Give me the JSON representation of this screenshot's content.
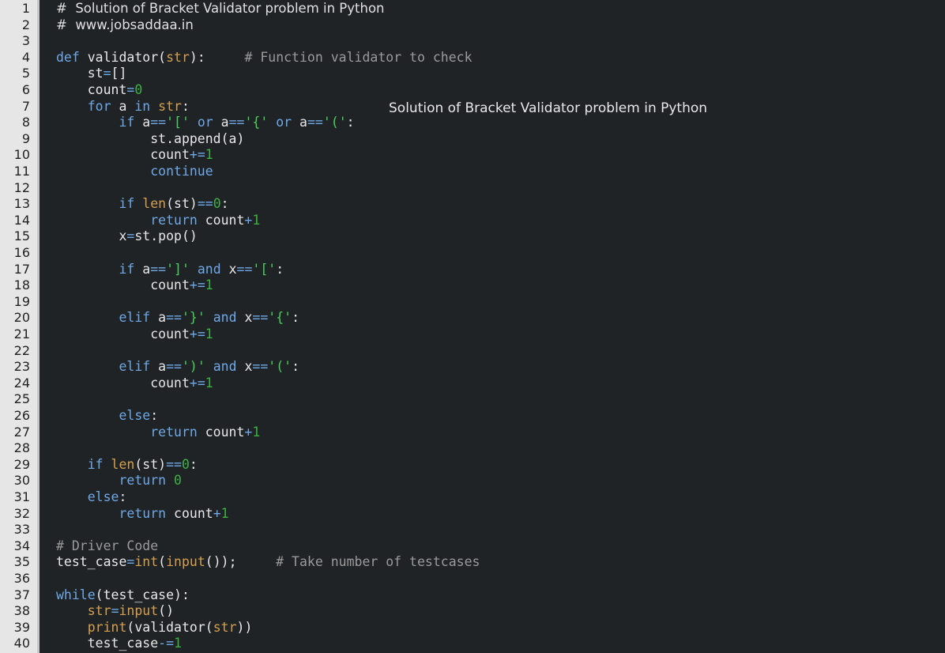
{
  "editor": {
    "overlay_title": "Solution of Bracket Validator problem in Python",
    "colors": {
      "background": "#1f2326",
      "gutter": "#e6e6e6",
      "keyword": "#6fa8e6",
      "builtin": "#d4a04f",
      "string": "#4ad05a",
      "number": "#3cb043",
      "comment": "#9a9a9a",
      "text": "#e8e8e8"
    },
    "lines": [
      {
        "n": "1",
        "prose": true,
        "tokens": [
          [
            "hdr",
            "#  Solution of Bracket Validator problem in Python"
          ]
        ]
      },
      {
        "n": "2",
        "prose": true,
        "tokens": [
          [
            "hdr",
            "#  www.jobsaddaa.in"
          ]
        ]
      },
      {
        "n": "3",
        "tokens": []
      },
      {
        "n": "4",
        "tokens": [
          [
            "kw",
            "def"
          ],
          [
            "pl",
            " validator("
          ],
          [
            "bi",
            "str"
          ],
          [
            "pl",
            "):     "
          ],
          [
            "com",
            "# Function validator to check"
          ]
        ]
      },
      {
        "n": "5",
        "tokens": [
          [
            "pl",
            "    st"
          ],
          [
            "op",
            "="
          ],
          [
            "pl",
            "[]"
          ]
        ]
      },
      {
        "n": "6",
        "tokens": [
          [
            "pl",
            "    count"
          ],
          [
            "op",
            "="
          ],
          [
            "num",
            "0"
          ]
        ]
      },
      {
        "n": "7",
        "tokens": [
          [
            "kw",
            "    for"
          ],
          [
            "pl",
            " a "
          ],
          [
            "kw",
            "in"
          ],
          [
            "pl",
            " "
          ],
          [
            "bi",
            "str"
          ],
          [
            "pl",
            ":"
          ]
        ]
      },
      {
        "n": "8",
        "tokens": [
          [
            "kw",
            "        if"
          ],
          [
            "pl",
            " a"
          ],
          [
            "op",
            "=="
          ],
          [
            "str",
            "'['"
          ],
          [
            "pl",
            " "
          ],
          [
            "kw",
            "or"
          ],
          [
            "pl",
            " a"
          ],
          [
            "op",
            "=="
          ],
          [
            "str",
            "'{'"
          ],
          [
            "pl",
            " "
          ],
          [
            "kw",
            "or"
          ],
          [
            "pl",
            " a"
          ],
          [
            "op",
            "=="
          ],
          [
            "str",
            "'('"
          ],
          [
            "pl",
            ":"
          ]
        ]
      },
      {
        "n": "9",
        "tokens": [
          [
            "pl",
            "            st.append(a)"
          ]
        ]
      },
      {
        "n": "10",
        "tokens": [
          [
            "pl",
            "            count"
          ],
          [
            "op",
            "+="
          ],
          [
            "num",
            "1"
          ]
        ]
      },
      {
        "n": "11",
        "tokens": [
          [
            "kw",
            "            continue"
          ]
        ]
      },
      {
        "n": "12",
        "tokens": []
      },
      {
        "n": "13",
        "tokens": [
          [
            "kw",
            "        if"
          ],
          [
            "pl",
            " "
          ],
          [
            "bi",
            "len"
          ],
          [
            "pl",
            "(st)"
          ],
          [
            "op",
            "=="
          ],
          [
            "num",
            "0"
          ],
          [
            "pl",
            ":"
          ]
        ]
      },
      {
        "n": "14",
        "tokens": [
          [
            "kw",
            "            return"
          ],
          [
            "pl",
            " count"
          ],
          [
            "op",
            "+"
          ],
          [
            "num",
            "1"
          ]
        ]
      },
      {
        "n": "15",
        "tokens": [
          [
            "pl",
            "        x"
          ],
          [
            "op",
            "="
          ],
          [
            "pl",
            "st.pop()"
          ]
        ]
      },
      {
        "n": "16",
        "tokens": []
      },
      {
        "n": "17",
        "tokens": [
          [
            "kw",
            "        if"
          ],
          [
            "pl",
            " a"
          ],
          [
            "op",
            "=="
          ],
          [
            "str",
            "']'"
          ],
          [
            "pl",
            " "
          ],
          [
            "kw",
            "and"
          ],
          [
            "pl",
            " x"
          ],
          [
            "op",
            "=="
          ],
          [
            "str",
            "'['"
          ],
          [
            "pl",
            ":"
          ]
        ]
      },
      {
        "n": "18",
        "tokens": [
          [
            "pl",
            "            count"
          ],
          [
            "op",
            "+="
          ],
          [
            "num",
            "1"
          ]
        ]
      },
      {
        "n": "19",
        "tokens": []
      },
      {
        "n": "20",
        "tokens": [
          [
            "kw",
            "        elif"
          ],
          [
            "pl",
            " a"
          ],
          [
            "op",
            "=="
          ],
          [
            "str",
            "'}'"
          ],
          [
            "pl",
            " "
          ],
          [
            "kw",
            "and"
          ],
          [
            "pl",
            " x"
          ],
          [
            "op",
            "=="
          ],
          [
            "str",
            "'{'"
          ],
          [
            "pl",
            ":"
          ]
        ]
      },
      {
        "n": "21",
        "tokens": [
          [
            "pl",
            "            count"
          ],
          [
            "op",
            "+="
          ],
          [
            "num",
            "1"
          ]
        ]
      },
      {
        "n": "22",
        "tokens": []
      },
      {
        "n": "23",
        "tokens": [
          [
            "kw",
            "        elif"
          ],
          [
            "pl",
            " a"
          ],
          [
            "op",
            "=="
          ],
          [
            "str",
            "')'"
          ],
          [
            "pl",
            " "
          ],
          [
            "kw",
            "and"
          ],
          [
            "pl",
            " x"
          ],
          [
            "op",
            "=="
          ],
          [
            "str",
            "'('"
          ],
          [
            "pl",
            ":"
          ]
        ]
      },
      {
        "n": "24",
        "tokens": [
          [
            "pl",
            "            count"
          ],
          [
            "op",
            "+="
          ],
          [
            "num",
            "1"
          ]
        ]
      },
      {
        "n": "25",
        "tokens": []
      },
      {
        "n": "26",
        "tokens": [
          [
            "kw",
            "        else"
          ],
          [
            "pl",
            ":"
          ]
        ]
      },
      {
        "n": "27",
        "tokens": [
          [
            "kw",
            "            return"
          ],
          [
            "pl",
            " count"
          ],
          [
            "op",
            "+"
          ],
          [
            "num",
            "1"
          ]
        ]
      },
      {
        "n": "28",
        "tokens": []
      },
      {
        "n": "29",
        "tokens": [
          [
            "kw",
            "    if"
          ],
          [
            "pl",
            " "
          ],
          [
            "bi",
            "len"
          ],
          [
            "pl",
            "(st)"
          ],
          [
            "op",
            "=="
          ],
          [
            "num",
            "0"
          ],
          [
            "pl",
            ":"
          ]
        ]
      },
      {
        "n": "30",
        "tokens": [
          [
            "kw",
            "        return"
          ],
          [
            "pl",
            " "
          ],
          [
            "num",
            "0"
          ]
        ]
      },
      {
        "n": "31",
        "tokens": [
          [
            "kw",
            "    else"
          ],
          [
            "pl",
            ":"
          ]
        ]
      },
      {
        "n": "32",
        "tokens": [
          [
            "kw",
            "        return"
          ],
          [
            "pl",
            " count"
          ],
          [
            "op",
            "+"
          ],
          [
            "num",
            "1"
          ]
        ]
      },
      {
        "n": "33",
        "tokens": []
      },
      {
        "n": "34",
        "tokens": [
          [
            "com",
            "# Driver Code"
          ]
        ]
      },
      {
        "n": "35",
        "tokens": [
          [
            "pl",
            "test_case"
          ],
          [
            "op",
            "="
          ],
          [
            "bi",
            "int"
          ],
          [
            "pl",
            "("
          ],
          [
            "bi",
            "input"
          ],
          [
            "pl",
            "());     "
          ],
          [
            "com",
            "# Take number of testcases"
          ]
        ]
      },
      {
        "n": "36",
        "tokens": []
      },
      {
        "n": "37",
        "tokens": [
          [
            "kw",
            "while"
          ],
          [
            "pl",
            "(test_case):"
          ]
        ]
      },
      {
        "n": "38",
        "tokens": [
          [
            "pl",
            "    "
          ],
          [
            "bi",
            "str"
          ],
          [
            "op",
            "="
          ],
          [
            "bi",
            "input"
          ],
          [
            "pl",
            "()"
          ]
        ]
      },
      {
        "n": "39",
        "tokens": [
          [
            "pl",
            "    "
          ],
          [
            "bi",
            "print"
          ],
          [
            "pl",
            "(validator("
          ],
          [
            "bi",
            "str"
          ],
          [
            "pl",
            "))"
          ]
        ]
      },
      {
        "n": "40",
        "tokens": [
          [
            "pl",
            "    test_case"
          ],
          [
            "op",
            "-="
          ],
          [
            "num",
            "1"
          ]
        ]
      }
    ]
  }
}
